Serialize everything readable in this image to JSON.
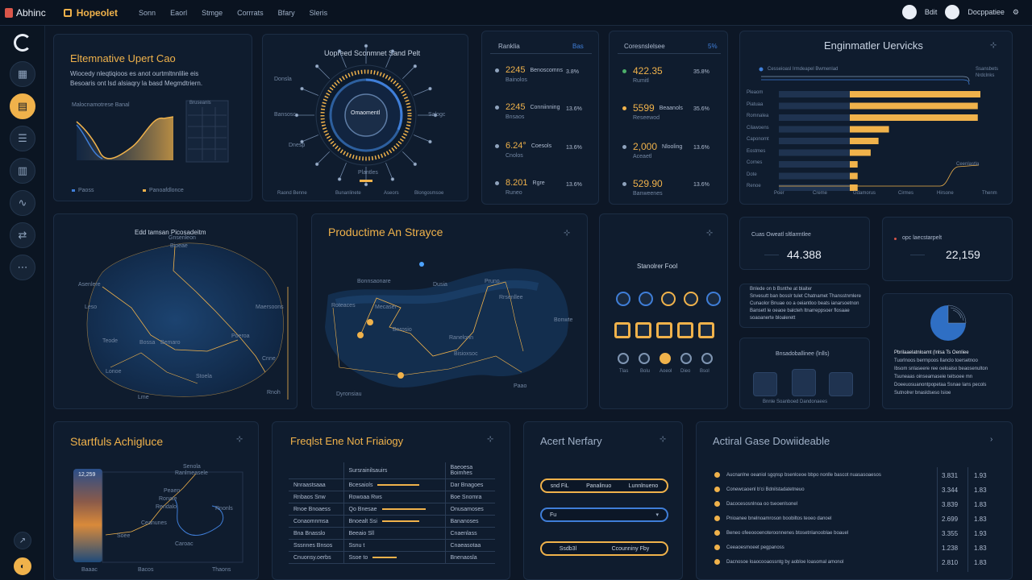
{
  "topbar": {
    "brand": "Abhinc",
    "app_name": "Hopeolet",
    "nav": [
      "Sonn",
      "Eaorl",
      "Stmge",
      "Corrrats",
      "Bfary",
      "Sleris"
    ],
    "user_label": "Bdit",
    "account_label": "Docppatiee"
  },
  "sidebar": {
    "items": [
      "home-icon",
      "grid-icon",
      "folder-icon",
      "list-icon",
      "chart-icon",
      "wave-icon",
      "sync-icon",
      "more-icon"
    ],
    "footer_items": [
      "arrow-icon",
      "logo-icon"
    ]
  },
  "panel1": {
    "title": "Eltemnative Upert Cao",
    "desc1": "Wiocedy nleqtiqioos es anot ourtmltnnlilie eis",
    "desc2": "Besoaris ont lsd alsiaqry la basd Megmdtriern.",
    "chart_label": "Malocnamotrese Banal",
    "legend": [
      "Paoss",
      "Panoafdlonce"
    ],
    "table_header": "Bruseanls"
  },
  "panel2": {
    "title": "Uopreed Sconmnet Sand Pelt",
    "center_label": "Omaomentl",
    "bottom_label": "Plantles",
    "legend": [
      "Raond Benne",
      "Bunanlinete",
      "Aseors",
      "Blongosmsoe"
    ],
    "ring_labels": [
      "Donsla",
      "Bansosc",
      "Dnesp",
      "Salogc"
    ]
  },
  "panel3": {
    "title": "Ranklia",
    "link": "Bas",
    "items": [
      {
        "value": "2245",
        "label": "Benoscomns",
        "sub": "Bainolos",
        "right": "3.8%"
      },
      {
        "value": "2245",
        "label": "Conniinning",
        "sub": "Bnsaos",
        "right": "13.6%"
      },
      {
        "value": "6.24°",
        "label": "Coesols",
        "sub": "Cnolos",
        "right": "13.6%"
      },
      {
        "value": "8.201",
        "label": "Rgre",
        "sub": "Runeo",
        "right": "13.6%"
      }
    ]
  },
  "panel4": {
    "title": "Coresnslelsee",
    "link": "5%",
    "items": [
      {
        "value": "422.35",
        "label": "",
        "sub": "Rumitl",
        "right": "35.8%"
      },
      {
        "value": "5599",
        "label": "Beaanols",
        "sub": "Reseewod",
        "right": "35.6%"
      },
      {
        "value": "2,000",
        "label": "Nlooling",
        "sub": "Aceaetl",
        "right": "13.6%"
      },
      {
        "value": "529.90",
        "label": "",
        "sub": "Banweenes",
        "right": "13.6%"
      }
    ]
  },
  "panel5": {
    "title": "Enginmatler Uervicks",
    "top_label": "Cesseioasl Irmdeapel Bwmenlad",
    "note1": "Ssansbets",
    "note2": "Nrdclnks",
    "categories": [
      "Pleaom",
      "Piatuaa",
      "Romnalea",
      "Cilawoens",
      "Caponomt",
      "Eostmes",
      "Cornes",
      "Dote",
      "Renoe"
    ],
    "bottom_labels": [
      "Poer",
      "Creme",
      "Gdamorus",
      "Cirmes",
      "Hirsone",
      "Thenm"
    ],
    "corner_note": "Ceenlastla"
  },
  "panel6": {
    "title": "Edd tamsan Picosadeitm",
    "labels": [
      "Asenlere",
      "Bioeae",
      "Gnsenleon",
      "Leso",
      "Maersoons",
      "Poeroa",
      "Bossa",
      "Bemaro",
      "Lonoe",
      "Teode",
      "Stoela",
      "Lme",
      "Rnoh",
      "Cnne"
    ]
  },
  "panel7": {
    "title": "Productime An Strayce",
    "labels": [
      "Bonnsaonare",
      "Roteaces",
      "Mecaser",
      "Bnrosio",
      "Pruno",
      "Rrsenllee",
      "Ranelonn",
      "Bisioxsoc",
      "Bonwte",
      "Paao",
      "Dyronsiau",
      "Dusia"
    ]
  },
  "panel8": {
    "title": "Stanolrer Fool",
    "icon_labels": [
      "Tlas",
      "Bolu",
      "Aoeol",
      "Dieo",
      "Bsol"
    ]
  },
  "panel9": {
    "label": "Cuas Oweatl sltlarmtlee",
    "value": "44.388"
  },
  "panel10": {
    "label": "opc laecstarpelt",
    "value": "22,159"
  },
  "panel11": {
    "lines": [
      "Bnlede on b Bsnthe at blaiter",
      "Snvesutt ban bosslr tulet Chatnamet Thansstnmlere",
      "Cunaolor Bnuae oo a oeiantloo beats ianarsoetnon",
      "Bansetl le oeaoe balcteh ltnarreppsoer flosaae",
      "soaoanerte bloalerett"
    ]
  },
  "panel12": {
    "lines": [
      "Pbrilaaelatnloamt (Inlsa Ts Oenliee",
      "Tuorlnoos berrnpoos llanclo toersetnoo",
      "Ibsom snlaseere ree oeloaiso beaosenulton",
      "Tsuneaas oinseamaseie teitsoee mn",
      "Doeeuosuanontpopetaa Ssnae lans pecols",
      "Sutnolrer bnasldseso lsioe"
    ]
  },
  "panel13": {
    "title": "Bnsadoballinee (lnlls)",
    "caption": "Bnnle Soanboed Dandonaees"
  },
  "panel14": {
    "title": "Startfuls Achigluce",
    "scale_value": "12,259",
    "labels": [
      "Senola",
      "Ranlmeasele",
      "Peaen",
      "Ronate",
      "Rendalo",
      "Ceanunes",
      "Rnonls",
      "Soee",
      "Baaac",
      "Bacos",
      "Thaons",
      "Caroac"
    ]
  },
  "panel15": {
    "title": "Freqlst Ene Not Friaiogy",
    "headers": [
      "",
      "Sursrainilsauirs",
      "Baeoesa Boimhes"
    ],
    "rows": [
      [
        "Nnraastsaaa",
        "Bcesaiols",
        "Dar Bnagoes"
      ],
      [
        "Rnbaos Snw",
        "Rowoaa Rws",
        "Boe Snomra"
      ],
      [
        "Rnoe Bnoaess",
        "Qo Bnesae",
        "Onusamoses"
      ],
      [
        "Conaomnmsa",
        "Bnoealt Ssi",
        "Bananoses"
      ],
      [
        "Bna Bnasslo",
        "Beeaio Sll",
        "Cnaenlass"
      ],
      [
        "Sssnnes Bnsos",
        "Ssnu t",
        "Cnaeasotaa"
      ],
      [
        "Cnuonsy.oerbs",
        "Ssoe to",
        "Bnenaosla"
      ]
    ]
  },
  "panel16": {
    "title": "Acert Nerfary",
    "pill1": [
      "snd FiL",
      "Panalinuo",
      "Lunnlnueno"
    ],
    "pill2": "Fu",
    "pill3": [
      "Ssdb3l",
      "Ccounniny Fby"
    ]
  },
  "panel17": {
    "title": "Actiral Gase Dowiideable",
    "rows": [
      {
        "label": "Aucnanlne oeaniol sgqnsp bsenlceoe bbpo nonlle bascot nuasasoaesos",
        "v1": "3.831",
        "v2": "1.93"
      },
      {
        "label": "Conewcaoenl b'ci Bdnilstadatetneuo",
        "v1": "3.344",
        "v2": "1.83"
      },
      {
        "label": "Dacocesosnlnoa oo tseoenlsonel",
        "v1": "3.839",
        "v2": "1.83"
      },
      {
        "label": "Pnioanee bnelnoamroson boobiltos teoeo danoel",
        "v1": "2.699",
        "v2": "1.83"
      },
      {
        "label": "Beneo ofeeoooenoteroonnenes btosetnlanooblae boauel",
        "v1": "3.355",
        "v2": "1.93"
      },
      {
        "label": "Ceeaoesmoeet pegpanoss",
        "v1": "1.238",
        "v2": "1.83"
      },
      {
        "label": "Dacnosoe loaocooaossntg by aobloe loasomal amonol",
        "v1": "2.810",
        "v2": "1.83"
      }
    ]
  }
}
